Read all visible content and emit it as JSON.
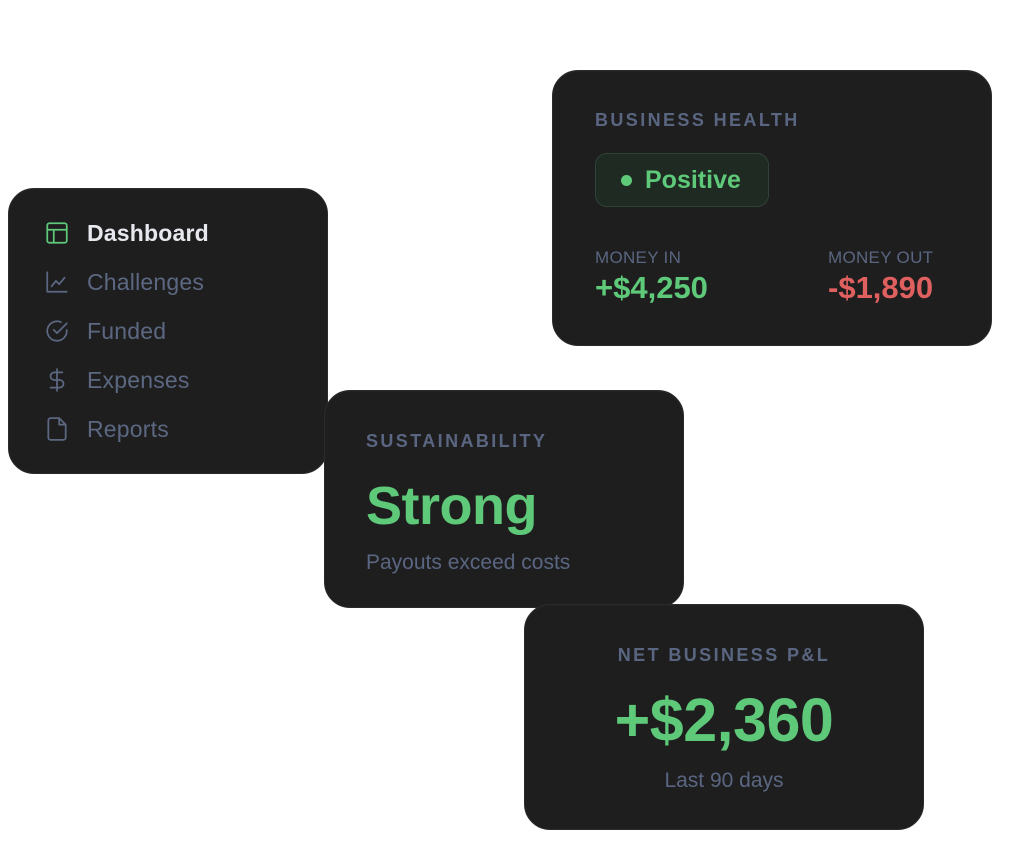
{
  "sidebar": {
    "items": [
      {
        "label": "Dashboard",
        "icon": "layout-icon",
        "active": true
      },
      {
        "label": "Challenges",
        "icon": "chart-line-icon",
        "active": false
      },
      {
        "label": "Funded",
        "icon": "check-circle-icon",
        "active": false
      },
      {
        "label": "Expenses",
        "icon": "dollar-icon",
        "active": false
      },
      {
        "label": "Reports",
        "icon": "file-icon",
        "active": false
      }
    ]
  },
  "health": {
    "title": "BUSINESS HEALTH",
    "status": "Positive",
    "money_in_label": "MONEY IN",
    "money_in_value": "+$4,250",
    "money_out_label": "MONEY OUT",
    "money_out_value": "-$1,890"
  },
  "sustainability": {
    "title": "SUSTAINABILITY",
    "value": "Strong",
    "subtitle": "Payouts exceed costs"
  },
  "pnl": {
    "title": "NET BUSINESS P&L",
    "value": "+$2,360",
    "period": "Last 90 days"
  },
  "colors": {
    "card_bg": "#1e1e1f",
    "positive": "#5fc97a",
    "negative": "#e05f5f",
    "muted": "#5a6681",
    "active_text": "#e6e8ee"
  }
}
